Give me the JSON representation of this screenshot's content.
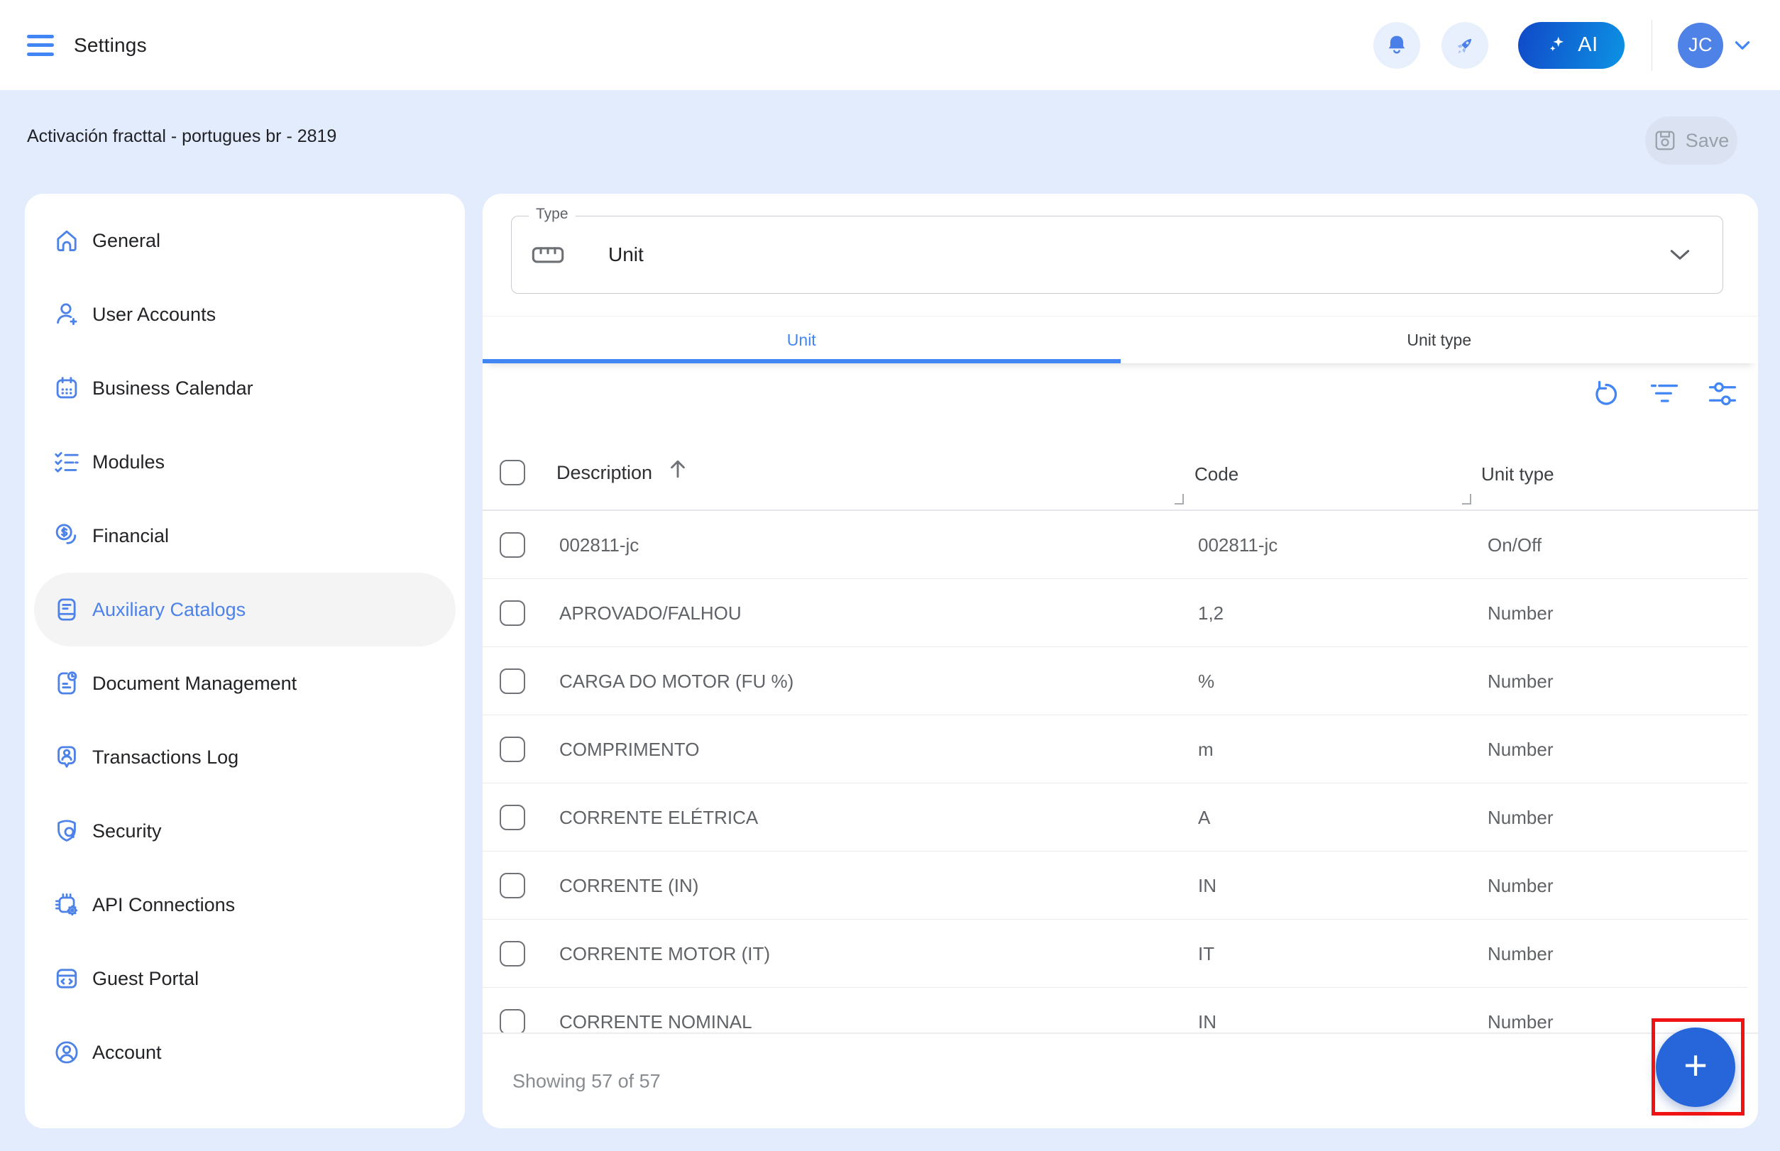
{
  "topbar": {
    "title": "Settings",
    "ai_label": "AI",
    "avatar_initials": "JC",
    "icons": [
      "menu-icon",
      "bell-icon",
      "rocket-icon",
      "ai-sparkle-icon",
      "chevron-down-icon"
    ]
  },
  "subheader": {
    "title": "Activación fracttal - portugues br - 2819",
    "save_label": "Save"
  },
  "sidebar": {
    "active_label": "Auxiliary Catalogs",
    "items": [
      {
        "label": "General",
        "icon": "home-icon"
      },
      {
        "label": "User Accounts",
        "icon": "user-plus-icon"
      },
      {
        "label": "Business Calendar",
        "icon": "calendar-icon"
      },
      {
        "label": "Modules",
        "icon": "checklist-icon"
      },
      {
        "label": "Financial",
        "icon": "dollar-coin-icon"
      },
      {
        "label": "Auxiliary Catalogs",
        "icon": "catalog-document-icon"
      },
      {
        "label": "Document Management",
        "icon": "document-clock-icon"
      },
      {
        "label": "Transactions Log",
        "icon": "person-badge-icon"
      },
      {
        "label": "Security",
        "icon": "shield-lock-icon"
      },
      {
        "label": "API Connections",
        "icon": "chip-gear-icon"
      },
      {
        "label": "Guest Portal",
        "icon": "browser-code-icon"
      },
      {
        "label": "Account",
        "icon": "person-circle-icon"
      }
    ]
  },
  "main": {
    "type_field": {
      "label": "Type",
      "value": "Unit",
      "icon": "ruler-icon"
    },
    "tabs": [
      {
        "label": "Unit",
        "active": true
      },
      {
        "label": "Unit type",
        "active": false
      }
    ],
    "toolbar_icons": [
      "refresh-icon",
      "filter-icon",
      "tune-sliders-icon"
    ],
    "table": {
      "columns": [
        "Description",
        "Code",
        "Unit type"
      ],
      "sort": {
        "column": "Description",
        "direction": "ascending"
      },
      "rows": [
        {
          "description": "002811-jc",
          "code": "002811-jc",
          "unit_type": "On/Off"
        },
        {
          "description": "APROVADO/FALHOU",
          "code": "1,2",
          "unit_type": "Number"
        },
        {
          "description": "CARGA DO MOTOR (FU %)",
          "code": "%",
          "unit_type": "Number"
        },
        {
          "description": "COMPRIMENTO",
          "code": "m",
          "unit_type": "Number"
        },
        {
          "description": "CORRENTE ELÉTRICA",
          "code": "A",
          "unit_type": "Number"
        },
        {
          "description": "CORRENTE (IN)",
          "code": "IN",
          "unit_type": "Number"
        },
        {
          "description": "CORRENTE MOTOR (IT)",
          "code": "IT",
          "unit_type": "Number"
        },
        {
          "description": "CORRENTE NOMINAL",
          "code": "IN",
          "unit_type": "Number"
        }
      ],
      "footer": "Showing 57 of 57"
    },
    "fab_label": "+"
  },
  "annotation": {
    "shape": "rectangle",
    "color": "#ef1313",
    "target": "add-button"
  },
  "colors": {
    "accent": "#4285f4",
    "sidebar_icon": "#4d82e8",
    "fab": "#2766da",
    "page_background": "#e3ecfc",
    "ai_gradient_start": "#1148c8",
    "ai_gradient_end": "#0c93e4"
  }
}
